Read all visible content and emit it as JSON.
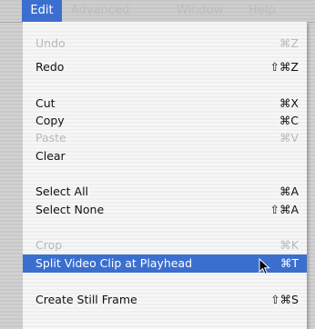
{
  "menubar": {
    "items": [
      "Edit",
      "Advanced",
      "Window",
      "Help"
    ]
  },
  "menu": {
    "items": [
      {
        "label": "Undo",
        "shortcut": "⌘Z",
        "enabled": false
      },
      {
        "label": "Redo",
        "shortcut": "⇧⌘Z",
        "enabled": true
      },
      {
        "label": "Cut",
        "shortcut": "⌘X",
        "enabled": true
      },
      {
        "label": "Copy",
        "shortcut": "⌘C",
        "enabled": true
      },
      {
        "label": "Paste",
        "shortcut": "⌘V",
        "enabled": false
      },
      {
        "label": "Clear",
        "shortcut": "",
        "enabled": true
      },
      {
        "label": "Select All",
        "shortcut": "⌘A",
        "enabled": true
      },
      {
        "label": "Select None",
        "shortcut": "⇧⌘A",
        "enabled": true
      },
      {
        "label": "Crop",
        "shortcut": "⌘K",
        "enabled": false
      },
      {
        "label": "Split Video Clip at Playhead",
        "shortcut": "⌘T",
        "enabled": true,
        "highlighted": true
      },
      {
        "label": "Create Still Frame",
        "shortcut": "⇧⌘S",
        "enabled": true
      }
    ]
  },
  "colors": {
    "highlight": "#3b6fcf",
    "disabled_text": "#b9b9b9"
  }
}
